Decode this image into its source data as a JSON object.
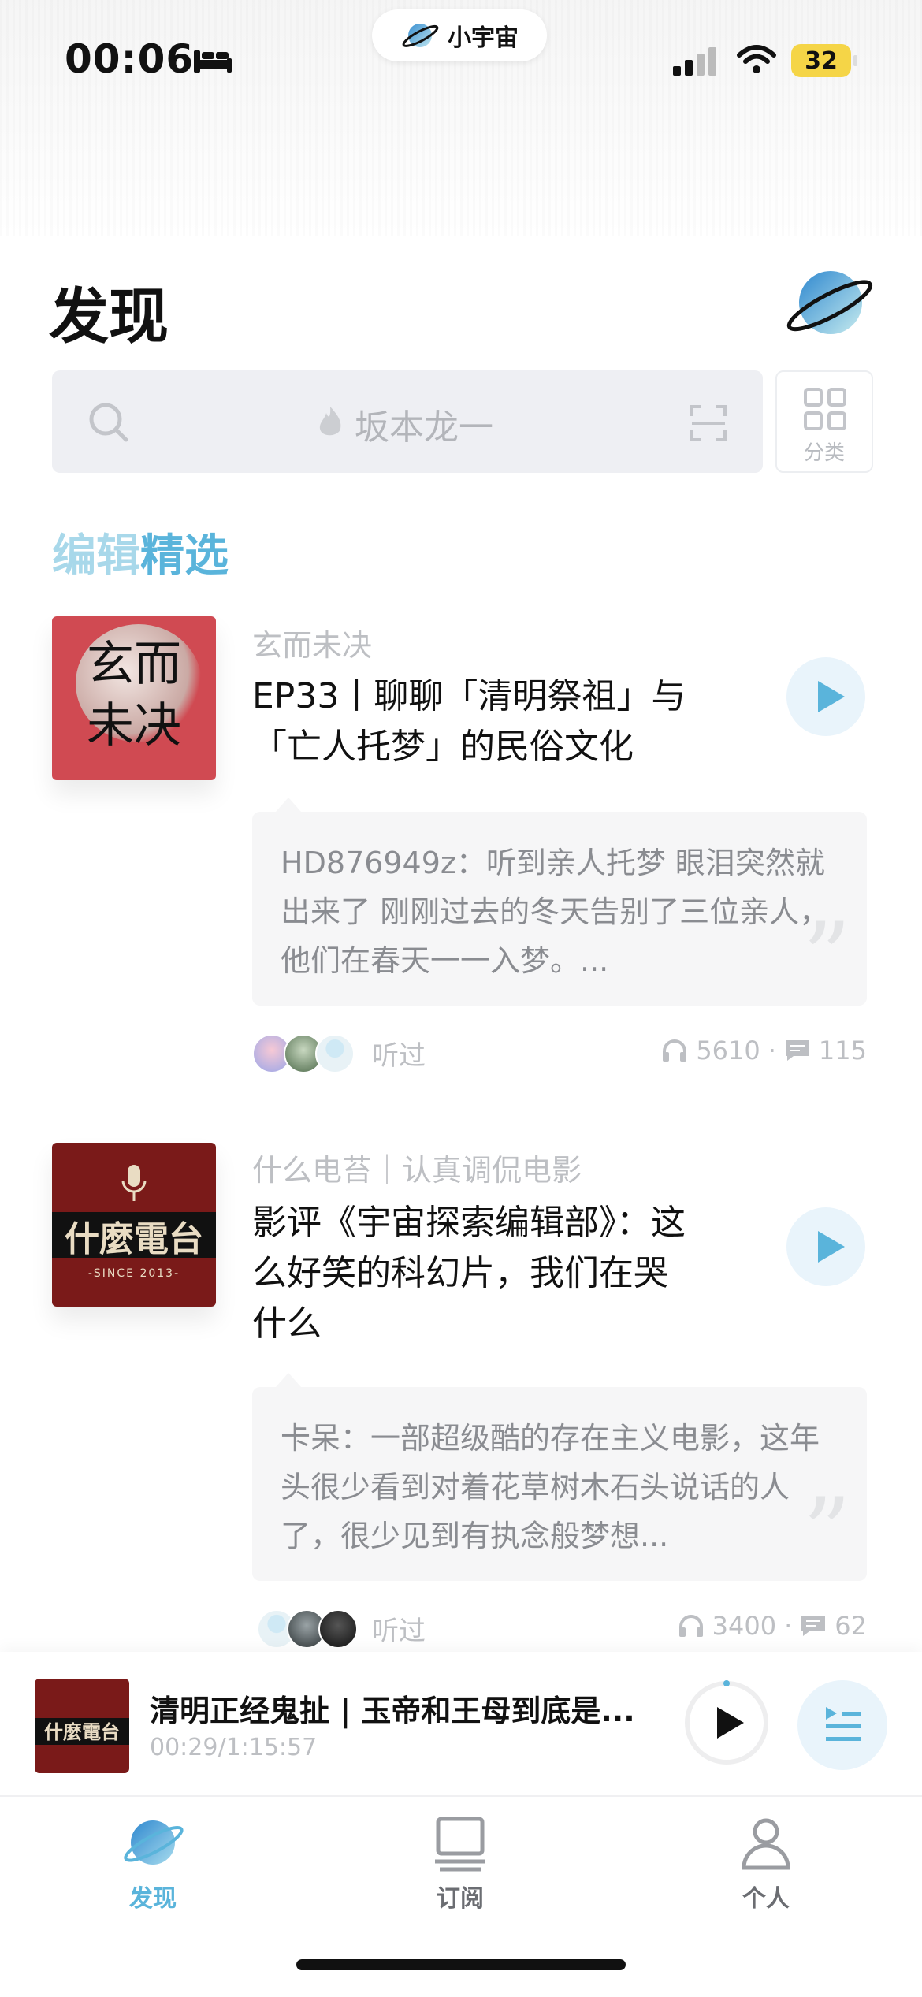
{
  "status": {
    "time": "00:06",
    "battery": "32",
    "brand": "小宇宙"
  },
  "header": {
    "title": "发现"
  },
  "search": {
    "placeholder": "坂本龙一",
    "category_label": "分类"
  },
  "section": {
    "title_a": "编辑",
    "title_b": "精选"
  },
  "feed": [
    {
      "cover_text_line1": "玄而",
      "cover_text_line2": "未决",
      "podcast": "玄而未决",
      "title": "EP33丨聊聊「清明祭祖」与「亡人托梦」的民俗文化",
      "comment_user": "HD876949z：",
      "comment_text": "听到亲人托梦 眼泪突然就出来了 刚刚过去的冬天告别了三位亲人，他们在春天一一入梦。...",
      "heard_label": "听过",
      "plays": "5610",
      "comments": "115"
    },
    {
      "cover_text": "什麼電台",
      "cover_since": "-SINCE 2013-",
      "podcast": "什么电苔｜认真调侃电影",
      "title": "影评《宇宙探索编辑部》：这么好笑的科幻片，我们在哭什么",
      "comment_user": "卡呆：",
      "comment_text": "一部超级酷的存在主义电影，这年头很少看到对着花草树木石头说话的人了，很少见到有执念般梦想...",
      "heard_label": "听过",
      "plays": "3400",
      "comments": "62"
    }
  ],
  "player": {
    "title": "清明正经鬼扯 | 玉帝和王母到底是...",
    "time": "00:29/1:15:57"
  },
  "tabs": [
    {
      "label": "发现",
      "active": true
    },
    {
      "label": "订阅",
      "active": false
    },
    {
      "label": "个人",
      "active": false
    }
  ],
  "colors": {
    "accent": "#5ab4db",
    "accent_light": "#a8d8ea",
    "muted": "#bdbfc3"
  }
}
